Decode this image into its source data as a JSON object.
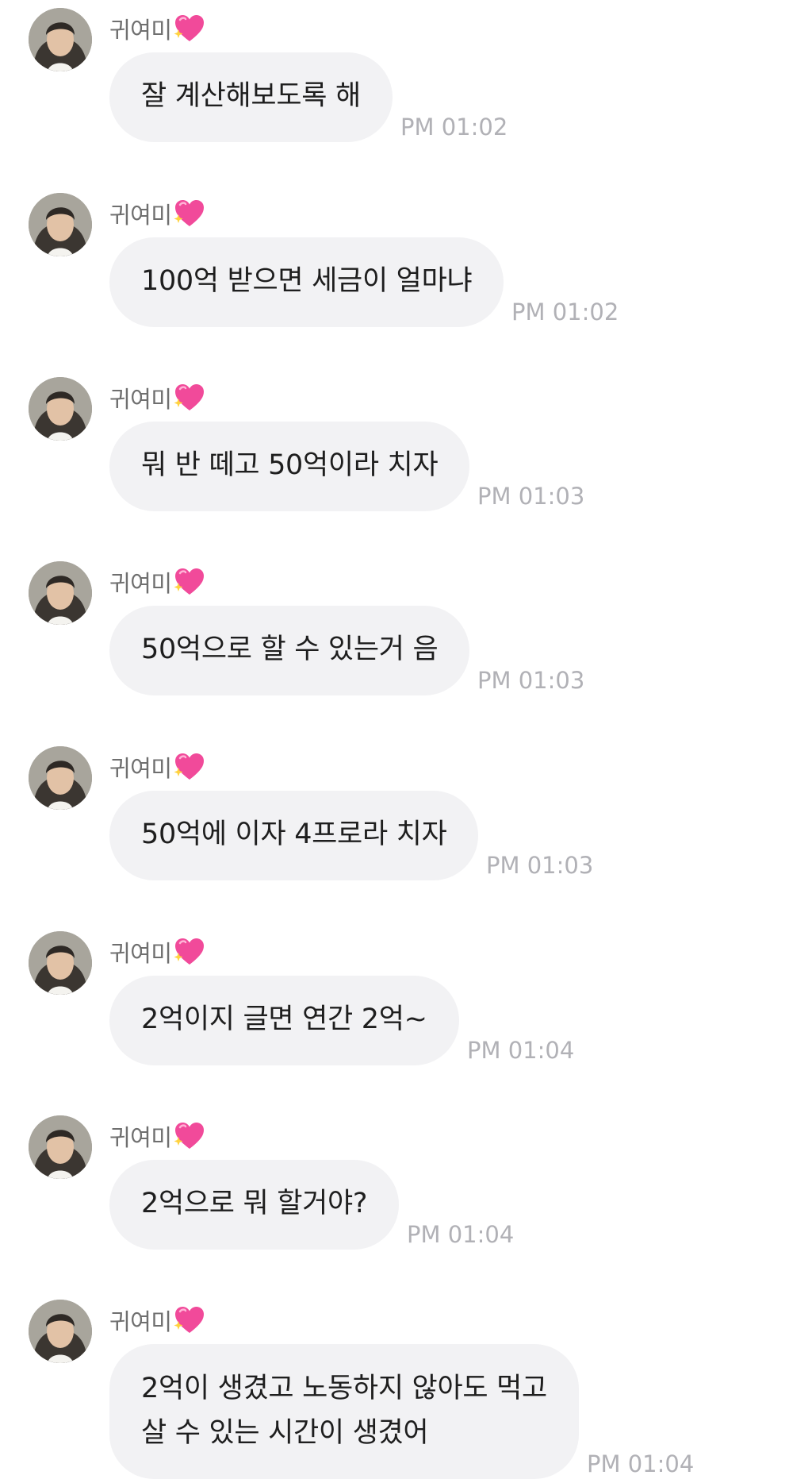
{
  "sender": {
    "name": "귀여미",
    "badge_icon": "sparkling-heart-icon"
  },
  "colors": {
    "bubble": "#f2f2f4",
    "text": "#1e1e1e",
    "timestamp": "#b1b1b6",
    "heart": "#f14a9a"
  },
  "messages": [
    {
      "text": "잘 계산해보도록 해",
      "time": "PM 01:02"
    },
    {
      "text": "100억 받으면 세금이 얼마냐",
      "time": "PM 01:02"
    },
    {
      "text": "뭐 반 떼고 50억이라 치자",
      "time": "PM 01:03"
    },
    {
      "text": "50억으로 할 수 있는거 음",
      "time": "PM 01:03"
    },
    {
      "text": "50억에 이자 4프로라 치자",
      "time": "PM 01:03"
    },
    {
      "text": "2억이지 글면 연간 2억~",
      "time": "PM 01:04"
    },
    {
      "text": "2억으로 뭐 할거야?",
      "time": "PM 01:04"
    },
    {
      "lines": [
        "2억이 생겼고 노동하지 않아도 먹고",
        "살 수 있는 시간이 생겼어"
      ],
      "time": "PM 01:04"
    }
  ]
}
